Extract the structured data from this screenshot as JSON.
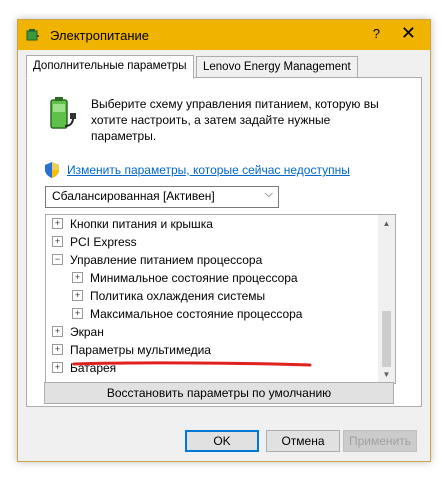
{
  "window": {
    "title": "Электропитание",
    "help_glyph": "?",
    "close_glyph": "✕"
  },
  "tabs": [
    {
      "label": "Дополнительные параметры",
      "active": true
    },
    {
      "label": "Lenovo Energy Management",
      "active": false
    }
  ],
  "panel": {
    "description": "Выберите схему управления питанием, которую вы хотите настроить, а затем задайте нужные параметры.",
    "change_link": "Изменить параметры, которые сейчас недоступны",
    "plan_select": {
      "value": "Сбалансированная [Активен]"
    }
  },
  "tree": [
    {
      "label": "Кнопки питания и крышка",
      "expander": "+"
    },
    {
      "label": "PCI Express",
      "expander": "+"
    },
    {
      "label": "Управление питанием процессора",
      "expander": "−"
    },
    {
      "label": "Минимальное состояние процессора",
      "expander": "+"
    },
    {
      "label": "Политика охлаждения системы",
      "expander": "+"
    },
    {
      "label": "Максимальное состояние процессора",
      "expander": "+"
    },
    {
      "label": "Экран",
      "expander": "+"
    },
    {
      "label": "Параметры мультимедиа",
      "expander": "+"
    },
    {
      "label": "Батарея",
      "expander": "+"
    }
  ],
  "restore_button": "Восстановить параметры по умолчанию",
  "buttons": {
    "ok": "OK",
    "cancel": "Отмена",
    "apply": "Применить"
  },
  "colors": {
    "titlebar": "#f0b400",
    "link": "#0066cc",
    "annotation": "#e0201c"
  },
  "icons": {
    "app": "power-options-icon",
    "battery": "battery-plug-icon",
    "shield": "uac-shield-icon"
  }
}
